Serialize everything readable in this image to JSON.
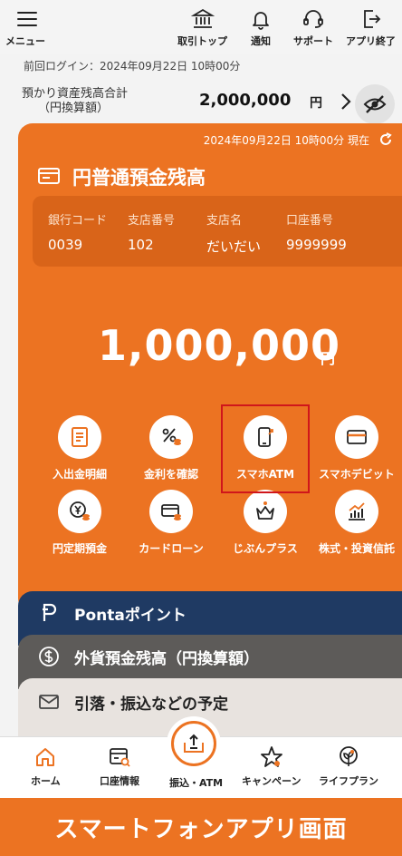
{
  "header": {
    "menu_label": "メニュー",
    "top_label": "取引トップ",
    "notify_label": "通知",
    "support_label": "サポート",
    "exit_label": "アプリ終了"
  },
  "last_login": "前回ログイン：2024年09月22日 10時00分",
  "assets": {
    "label_line1": "預かり資産残高合計",
    "label_line2": "（円換算額）",
    "amount": "2,000,000",
    "unit": "円"
  },
  "account_card": {
    "timestamp": "2024年09月22日 10時00分 現在",
    "title": "円普通預金残高",
    "info": [
      {
        "key": "銀行コード",
        "value": "0039"
      },
      {
        "key": "支店番号",
        "value": "102"
      },
      {
        "key": "支店名",
        "value": "だいだい"
      },
      {
        "key": "口座番号",
        "value": "9999999"
      }
    ],
    "balance": "1,000,000",
    "balance_unit": "円",
    "color": "#ec7322"
  },
  "menu": [
    {
      "label": "入出金明細",
      "icon": "statement-icon"
    },
    {
      "label": "金利を確認",
      "icon": "interest-rate-icon"
    },
    {
      "label": "スマホATM",
      "icon": "smartphone-atm-icon"
    },
    {
      "label": "スマホデビット",
      "icon": "debit-card-icon"
    },
    {
      "label": "円定期預金",
      "icon": "yen-deposit-icon"
    },
    {
      "label": "カードローン",
      "icon": "card-loan-icon"
    },
    {
      "label": "じぶんプラス",
      "icon": "crown-icon"
    },
    {
      "label": "株式・投資信託",
      "icon": "stock-chart-icon"
    }
  ],
  "stack_cards": [
    {
      "label": "Pontaポイント",
      "color": "#1f3a63"
    },
    {
      "label": "外貨預金残高（円換算額）",
      "color": "#5d5b59"
    },
    {
      "label": "引落・振込などの予定",
      "color": "#e8e3df"
    }
  ],
  "bottom_nav": [
    {
      "label": "ホーム",
      "icon": "home-icon"
    },
    {
      "label": "口座情報",
      "icon": "account-info-icon"
    },
    {
      "label": "振込・ATM",
      "icon": "transfer-atm-icon"
    },
    {
      "label": "キャンペーン",
      "icon": "star-icon"
    },
    {
      "label": "ライフプラン",
      "icon": "sprout-icon"
    }
  ],
  "banner": "スマートフォンアプリ画面"
}
